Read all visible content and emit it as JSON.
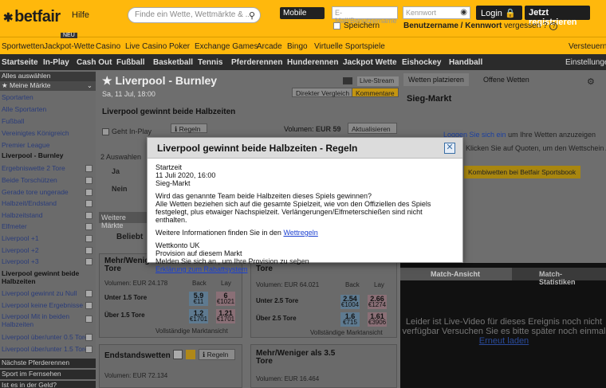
{
  "header": {
    "logo": "betfair",
    "help": "Hilfe",
    "search_placeholder": "Finde ein Wette, Wettmärkte & ...",
    "mobile": "Mobile",
    "email_placeholder": "E-Mail/Benutzername",
    "password_placeholder": "Kennwort",
    "login": "Login",
    "register": "Jetzt registrieren",
    "remember": "Speichern",
    "forgot_prefix": "Benutzername / Kennwort",
    "forgot_suffix": "vergessen ?",
    "versteuern": "Versteuern"
  },
  "product_nav": {
    "new_badge": "NEU",
    "items": [
      "Sportwetten",
      "Jackpot-Wette",
      "Casino",
      "Live Casino",
      "Poker",
      "Exchange Games",
      "Arcade",
      "Bingo",
      "Virtuelle Sportspiele"
    ]
  },
  "sport_nav": {
    "items": [
      "Startseite",
      "In-Play",
      "Cash Out",
      "Fußball",
      "Basketball",
      "Tennis",
      "Pferderennen",
      "Hunderennen",
      "Jackpot Wette",
      "Eishockey",
      "Handball"
    ],
    "settings": "Einstellungen"
  },
  "sidebar": {
    "items": [
      {
        "label": "Alles auswählen",
        "kind": "head"
      },
      {
        "label": "Meine Märkte",
        "kind": "star"
      },
      {
        "label": "Sportarten",
        "kind": "link"
      },
      {
        "label": "Alle Sportarten",
        "kind": "link"
      },
      {
        "label": "Fußball",
        "kind": "link"
      },
      {
        "label": "Vereinigtes Königreich",
        "kind": "link"
      },
      {
        "label": "Premier League",
        "kind": "link"
      },
      {
        "label": "Liverpool - Burnley",
        "kind": "bold"
      },
      {
        "label": "Ergebniswette 2 Tore",
        "kind": "chk"
      },
      {
        "label": "Beide Torschützen",
        "kind": "chk"
      },
      {
        "label": "Gerade tore ungerade",
        "kind": "chk"
      },
      {
        "label": "Halbzeit/Endstand",
        "kind": "chk"
      },
      {
        "label": "Halbzeitstand",
        "kind": "chk"
      },
      {
        "label": "Elfmeter",
        "kind": "chk"
      },
      {
        "label": "Liverpool +1",
        "kind": "chk"
      },
      {
        "label": "Liverpool +2",
        "kind": "chk"
      },
      {
        "label": "Liverpool +3",
        "kind": "chk"
      },
      {
        "label": "Liverpool gewinnt beide Halbzeiten",
        "kind": "bold2"
      },
      {
        "label": "Liverpool gewinnt zu Null",
        "kind": "chk"
      },
      {
        "label": "Liverpool keine Ergebnisse",
        "kind": "chk"
      },
      {
        "label": "Liverpool Mit in beiden Halbzeiten",
        "kind": "chk"
      },
      {
        "label": "Liverpool über/unter 0.5 Tore",
        "kind": "chk"
      },
      {
        "label": "Liverpool über/unter 1.5 Tore",
        "kind": "chk"
      },
      {
        "label": "Nächste Pferderennen",
        "kind": "dark"
      },
      {
        "label": "Sport im Fernsehen",
        "kind": "dark"
      },
      {
        "label": "Ist es in der Geld?",
        "kind": "dark"
      }
    ]
  },
  "event": {
    "title": "Liverpool - Burnley",
    "date": "Sa, 11 Jul, 18:00",
    "live_stream": "Live-Stream",
    "direct_compare": "Direkter Vergleich",
    "comments": "Kommentare",
    "market_title": "Liverpool gewinnt beide Halbzeiten",
    "going_in_play": "Geht In-Play",
    "rules": "Regeln",
    "volume_label": "Volumen:",
    "volume_value": "EUR 59",
    "refresh": "Aktualisieren",
    "selections": "2 Auswahlen",
    "sel_yes": "Ja",
    "sel_no": "Nein",
    "more_markets": "Weitere Märkte",
    "popular": "Beliebt"
  },
  "cards": {
    "c1": {
      "title": "Mehr/Weniger als 1.5 Tore",
      "volume": "Volumen: EUR 24.178",
      "back": "Back",
      "lay": "Lay",
      "rows": [
        {
          "name": "Unter 1.5 Tore",
          "back": "5.9",
          "back_sub": "€11",
          "lay": "6",
          "lay_sub": "€1021"
        },
        {
          "name": "Über 1.5 Tore",
          "back": "1.2",
          "back_sub": "€1701",
          "lay": "1.21",
          "lay_sub": "€1701"
        }
      ],
      "full": "Vollständige Marktansicht"
    },
    "c2": {
      "title": "Mehr/Weniger als 2.5 Tore",
      "volume": "Volumen: EUR 64.021",
      "back": "Back",
      "lay": "Lay",
      "rows": [
        {
          "name": "Unter 2.5 Tore",
          "back": "2.54",
          "back_sub": "€1004",
          "lay": "2.66",
          "lay_sub": "€1274"
        },
        {
          "name": "Über 2.5 Tore",
          "back": "1.6",
          "back_sub": "€715",
          "lay": "1.61",
          "lay_sub": "€3906"
        }
      ],
      "full": "Vollständige Marktansicht"
    },
    "c3": {
      "title": "Endstandswetten",
      "volume": "Volumen: EUR 72.134",
      "rules": "Regeln"
    },
    "c4": {
      "title": "Mehr/Weniger als 3.5 Tore",
      "volume": "Volumen: EUR 16.464"
    }
  },
  "right_panel": {
    "tab_place": "Wetten platzieren",
    "tab_open": "Offene Wetten",
    "title": "Sieg-Markt",
    "login_prompt_link": "Loggen Sie sich ein",
    "login_prompt_text": "um Ihre Wetten anzuzeigen",
    "add_selection_text": "Klicken Sie auf Quoten, um den Wettschein Auswahlen hinzuzufügen.",
    "combo_button": "Kombiwetten bei Betfair Sportsbook",
    "tab_match": "Match-Ansicht",
    "tab_stats": "Match-Statistiken",
    "video_message": "Leider ist Live-Video für dieses Ereignis noch nicht verfügbar Versuchen Sie es bitte später noch einmal",
    "retry": "Erneut laden"
  },
  "modal": {
    "title": "Liverpool gewinnt beide Halbzeiten - Regeln",
    "start_label": "Startzeit",
    "start_value": "11 Juli 2020, 16:00",
    "market_type": "Sieg-Markt",
    "question": "Wird das genannte Team beide Halbzeiten dieses Spiels gewinnen?",
    "rule_text": "Alle Wetten beziehen sich auf die gesamte Spielzeit, wie von den Offiziellen des Spiels festgelegt, plus etwaiger Nachspielzeit. Verlängerungen/Elfmeterschießen sind nicht enthalten.",
    "more_info_prefix": "Weitere Informationen finden Sie in den",
    "more_info_link": "Wettregeln",
    "account": "Wettkonto UK",
    "commission": "Provision auf diesem Markt",
    "login_commission": "Melden Sie sich an , um Ihre Provision zu sehen",
    "rebate_link": "Erklärung zum Rabattsystem"
  }
}
